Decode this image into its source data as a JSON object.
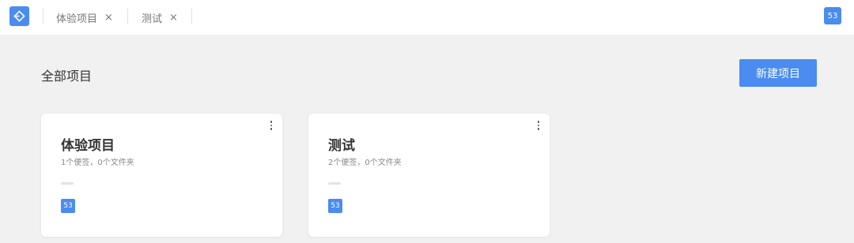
{
  "header": {
    "tabs": [
      {
        "label": "体验项目",
        "close": "×"
      },
      {
        "label": "测试",
        "close": "×"
      }
    ],
    "user_badge": "53"
  },
  "main": {
    "title": "全部项目",
    "new_button": "新建项目",
    "projects": [
      {
        "name": "体验项目",
        "meta": "1个便签，0个文件夹",
        "member": "53"
      },
      {
        "name": "测试",
        "meta": "2个便签，0个文件夹",
        "member": "53"
      }
    ]
  },
  "colors": {
    "accent": "#4a8cf0",
    "page_bg": "#f1f1f1",
    "card_bg": "#ffffff"
  },
  "icons": {
    "logo": "app-logo-icon",
    "close": "close-icon",
    "more": "more-vertical-icon"
  }
}
